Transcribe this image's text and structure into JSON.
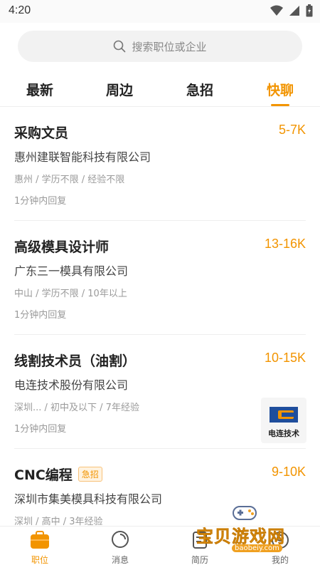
{
  "status_bar": {
    "time": "4:20"
  },
  "search": {
    "placeholder": "搜索职位或企业"
  },
  "tabs": [
    {
      "label": "最新",
      "active": false
    },
    {
      "label": "周边",
      "active": false
    },
    {
      "label": "急招",
      "active": false
    },
    {
      "label": "快聊",
      "active": true
    }
  ],
  "jobs": [
    {
      "title": "采购文员",
      "salary": "5-7K",
      "company": "惠州建联智能科技有限公司",
      "meta": "惠州 / 学历不限 / 经验不限",
      "reply": "1分钟内回复"
    },
    {
      "title": "高级模具设计师",
      "salary": "13-16K",
      "company": "广东三一模具有限公司",
      "meta": "中山 / 学历不限 / 10年以上",
      "reply": "1分钟内回复"
    },
    {
      "title": "线割技术员（油割）",
      "salary": "10-15K",
      "company": "电连技术股份有限公司",
      "meta": "深圳... / 初中及以下 / 7年经验",
      "reply": "1分钟内回复",
      "logo_text": "电连技术"
    },
    {
      "title": "CNC编程",
      "badge": "急招",
      "salary": "9-10K",
      "company": "深圳市集美模具科技有限公司",
      "meta": "深圳 / 高中 / 3年经验"
    }
  ],
  "bottom_nav": [
    {
      "label": "职位",
      "icon": "briefcase-icon",
      "active": true
    },
    {
      "label": "消息",
      "icon": "chat-bubble-icon",
      "active": false
    },
    {
      "label": "简历",
      "icon": "resume-icon",
      "active": false
    },
    {
      "label": "我的",
      "icon": "profile-icon",
      "active": false
    }
  ],
  "watermark": {
    "title": "宝贝游戏网",
    "url": "baobeiy.com"
  },
  "colors": {
    "accent": "#f29400",
    "text": "#222222",
    "muted": "#9a9a9a"
  }
}
